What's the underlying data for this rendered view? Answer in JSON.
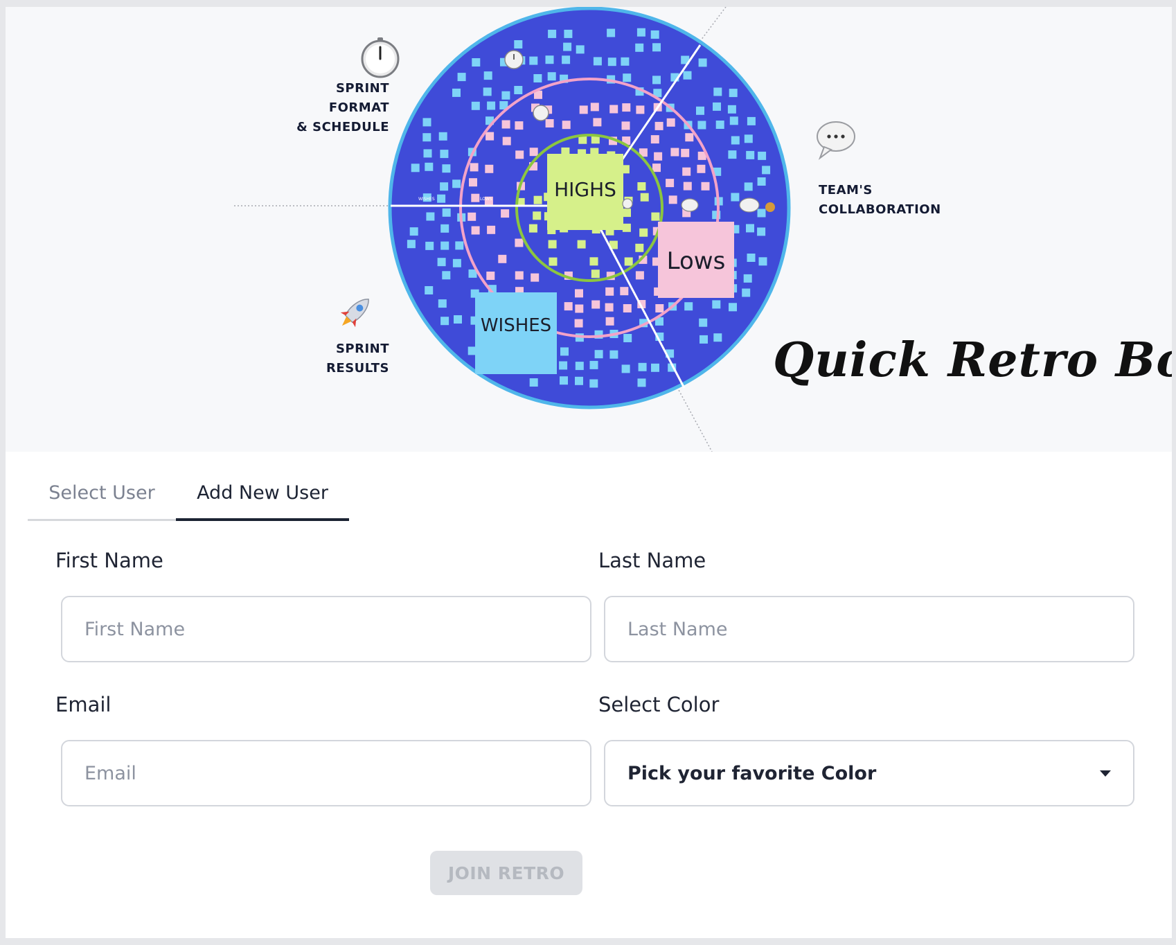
{
  "hero": {
    "labels": {
      "sprint_format": "SPRINT FORMAT",
      "schedule": "& SCHEDULE",
      "team": "TEAM'S",
      "collaboration": "COLLABORATION",
      "sprint_results": "SPRINT RESULTS"
    },
    "notes": {
      "highs": "HIGHS",
      "lows": "Lows",
      "wishes": "WISHES"
    },
    "ring_labels": {
      "wishes": "WISHES",
      "lows": "LOWS"
    },
    "title": "Quick Retro Board",
    "colors": {
      "board": "#3f4bd8",
      "note_blue": "#7ed3f7",
      "note_pink": "#f6c5da",
      "note_green": "#d6f08a",
      "ring_pink": "#f3a3c8",
      "ring_green": "#8cc63f"
    }
  },
  "tabs": {
    "select_user": "Select User",
    "add_new_user": "Add New User",
    "active": "add_new_user"
  },
  "form": {
    "first_name": {
      "label": "First Name",
      "placeholder": "First Name",
      "value": ""
    },
    "last_name": {
      "label": "Last Name",
      "placeholder": "Last Name",
      "value": ""
    },
    "email": {
      "label": "Email",
      "placeholder": "Email",
      "value": ""
    },
    "color": {
      "label": "Select Color",
      "selected": "Pick your favorite Color"
    },
    "submit": {
      "label": "JOIN RETRO",
      "disabled": true
    }
  }
}
